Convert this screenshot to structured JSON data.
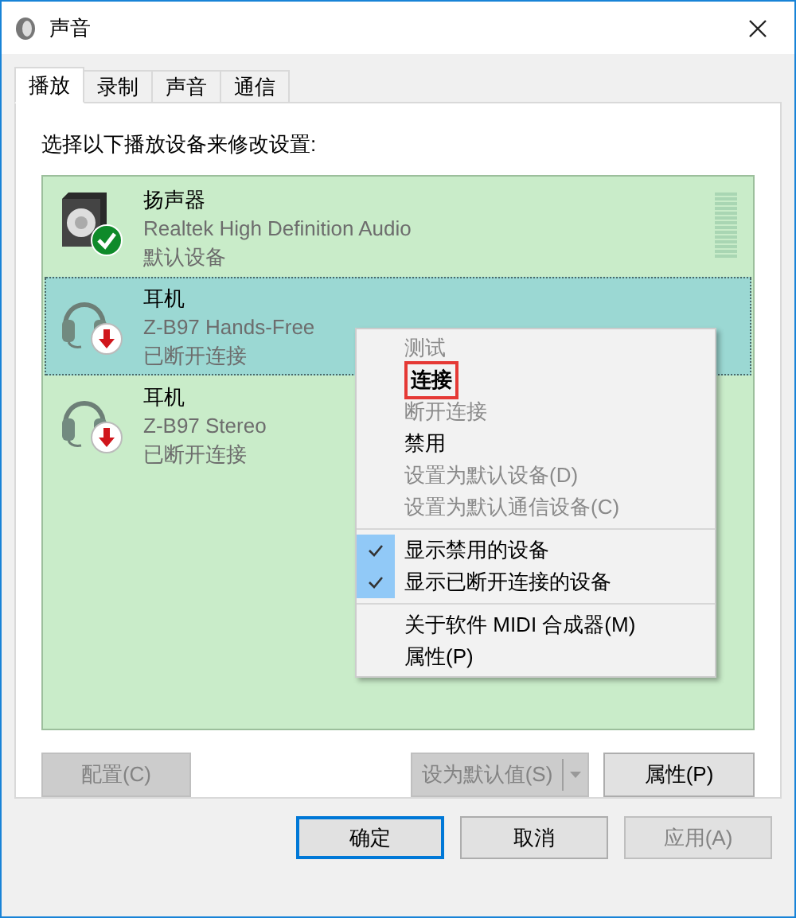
{
  "window": {
    "title": "声音"
  },
  "tabs": [
    {
      "label": "播放",
      "selected": true
    },
    {
      "label": "录制",
      "selected": false
    },
    {
      "label": "声音",
      "selected": false
    },
    {
      "label": "通信",
      "selected": false
    }
  ],
  "instruction": "选择以下播放设备来修改设置:",
  "devices": [
    {
      "kind": "speaker",
      "name": "扬声器",
      "driver": "Realtek High Definition Audio",
      "status": "默认设备",
      "badge": {
        "kind": "default"
      },
      "selected": false
    },
    {
      "kind": "headset",
      "name": "耳机",
      "driver": "Z-B97 Hands-Free",
      "status": "已断开连接",
      "badge": {
        "kind": "disconnected"
      },
      "selected": true
    },
    {
      "kind": "headset",
      "name": "耳机",
      "driver": "Z-B97 Stereo",
      "status": "已断开连接",
      "badge": {
        "kind": "disconnected"
      },
      "selected": false
    }
  ],
  "context_menu": [
    [
      {
        "label": "测试",
        "disabled": true,
        "bold": false,
        "checked": false,
        "boxed": false
      },
      {
        "label": "连接",
        "disabled": false,
        "bold": true,
        "checked": false,
        "boxed": true
      },
      {
        "label": "断开连接",
        "disabled": true,
        "bold": false,
        "checked": false,
        "boxed": false
      },
      {
        "label": "禁用",
        "disabled": false,
        "bold": false,
        "checked": false,
        "boxed": false
      },
      {
        "label": "设置为默认设备(D)",
        "disabled": true,
        "bold": false,
        "checked": false,
        "boxed": false
      },
      {
        "label": "设置为默认通信设备(C)",
        "disabled": true,
        "bold": false,
        "checked": false,
        "boxed": false
      }
    ],
    [
      {
        "label": "显示禁用的设备",
        "disabled": false,
        "bold": false,
        "checked": true,
        "boxed": false
      },
      {
        "label": "显示已断开连接的设备",
        "disabled": false,
        "bold": false,
        "checked": true,
        "boxed": false
      }
    ],
    [
      {
        "label": "关于软件 MIDI 合成器(M)",
        "disabled": false,
        "bold": false,
        "checked": false,
        "boxed": false
      },
      {
        "label": "属性(P)",
        "disabled": false,
        "bold": false,
        "checked": false,
        "boxed": false
      }
    ]
  ],
  "panel_buttons": {
    "configure": {
      "label": "配置(C)",
      "disabled": true
    },
    "set_default": {
      "label": "设为默认值(S)",
      "disabled": true
    },
    "properties": {
      "label": "属性(P)",
      "disabled": false
    }
  },
  "dialog_buttons": [
    {
      "label": "确定",
      "default": true,
      "disabled": false
    },
    {
      "label": "取消",
      "default": false,
      "disabled": false
    },
    {
      "label": "应用(A)",
      "default": false,
      "disabled": true
    }
  ]
}
